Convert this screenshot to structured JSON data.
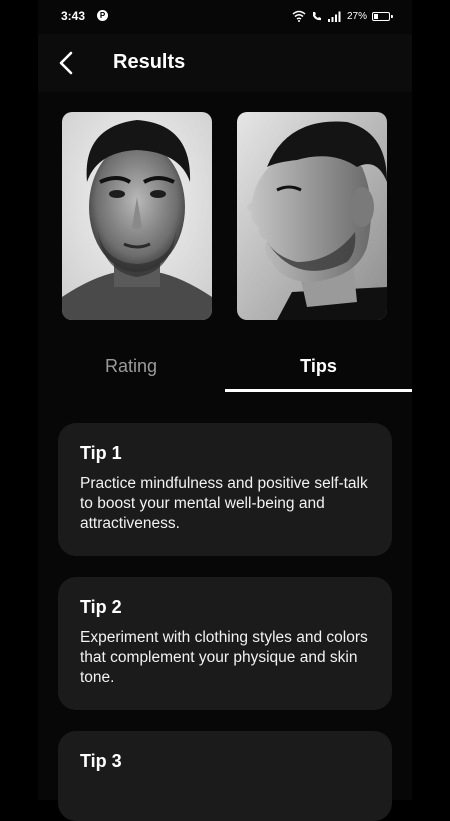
{
  "status_bar": {
    "time": "3:43",
    "app_icon_letter": "P",
    "battery_percent": "27%",
    "battery_level": 0.27
  },
  "header": {
    "title": "Results",
    "back_icon": "chevron-left-icon"
  },
  "photos": [
    {
      "description_icon": "face-front-photo"
    },
    {
      "description_icon": "face-profile-photo"
    }
  ],
  "tabs": [
    {
      "label": "Rating",
      "active": false
    },
    {
      "label": "Tips",
      "active": true
    }
  ],
  "tips": [
    {
      "title": "Tip 1",
      "text": "Practice mindfulness and positive self-talk to boost your mental well-being and attractiveness."
    },
    {
      "title": "Tip 2",
      "text": "Experiment with clothing styles and colors that complement your physique and skin tone."
    },
    {
      "title": "Tip 3",
      "text": ""
    }
  ],
  "colors": {
    "background": "#000000",
    "card": "#1b1b1b",
    "inactive_tab": "#9a9a9a",
    "accent": "#ffffff"
  }
}
